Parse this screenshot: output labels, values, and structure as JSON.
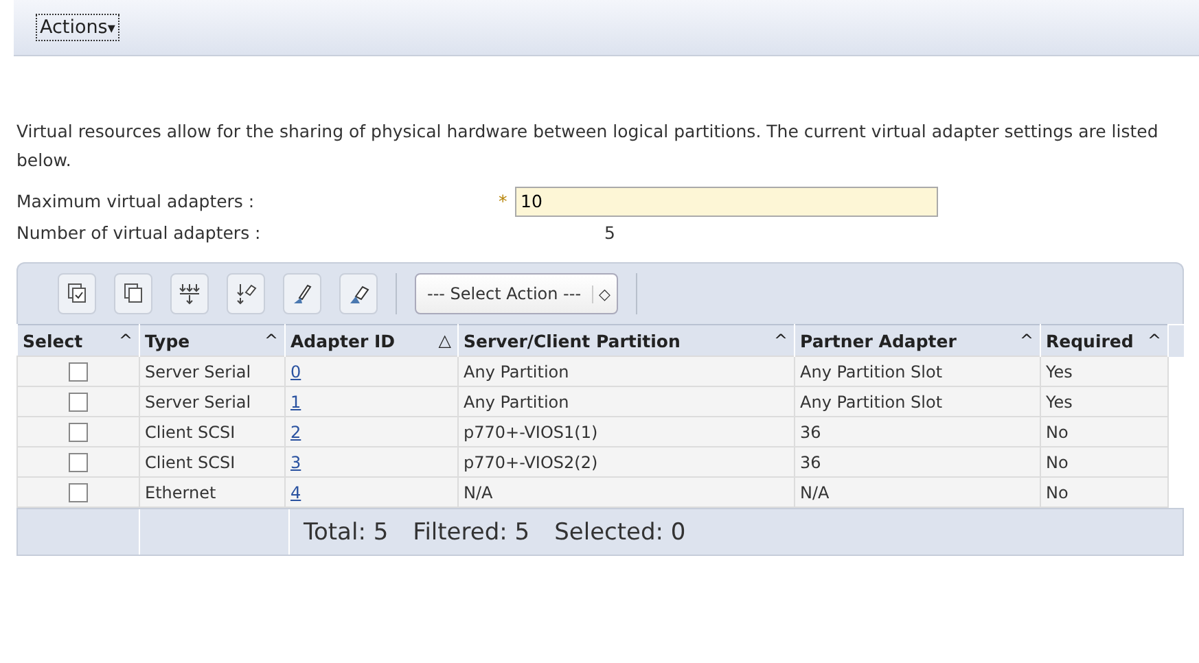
{
  "actions_menu": {
    "label": "Actions",
    "caret": "▾"
  },
  "description": "Virtual resources allow for the sharing of physical hardware between logical partitions. The current virtual adapter settings are listed below.",
  "fields": [
    {
      "kind": "input",
      "label": "Maximum virtual adapters :",
      "required_mark": "*",
      "value": "10"
    },
    {
      "kind": "readonly",
      "label": "Number of virtual adapters :",
      "value": "5"
    }
  ],
  "toolbar": {
    "select_action": {
      "value": "--- Select Action ---",
      "spinner": "◇"
    }
  },
  "table": {
    "columns": [
      {
        "label": "Select",
        "sort_mark": "^"
      },
      {
        "label": "Type",
        "sort_mark": "^"
      },
      {
        "label": "Adapter ID",
        "sort_mark": "△"
      },
      {
        "label": "Server/Client Partition",
        "sort_mark": "^"
      },
      {
        "label": "Partner Adapter",
        "sort_mark": "^"
      },
      {
        "label": "Required",
        "sort_mark": "^"
      }
    ],
    "rows": [
      {
        "checked": false,
        "type": "Server Serial",
        "adapter_id": "0",
        "partition": "Any Partition",
        "partner": "Any Partition Slot",
        "required": "Yes"
      },
      {
        "checked": false,
        "type": "Server Serial",
        "adapter_id": "1",
        "partition": "Any Partition",
        "partner": "Any Partition Slot",
        "required": "Yes"
      },
      {
        "checked": false,
        "type": "Client SCSI",
        "adapter_id": "2",
        "partition": "p770+-VIOS1(1)",
        "partner": "36",
        "required": "No"
      },
      {
        "checked": false,
        "type": "Client SCSI",
        "adapter_id": "3",
        "partition": "p770+-VIOS2(2)",
        "partner": "36",
        "required": "No"
      },
      {
        "checked": false,
        "type": "Ethernet",
        "adapter_id": "4",
        "partition": "N/A",
        "partner": "N/A",
        "required": "No"
      }
    ],
    "footer": [
      "Total: 5",
      "Filtered: 5",
      "Selected: 0"
    ]
  }
}
